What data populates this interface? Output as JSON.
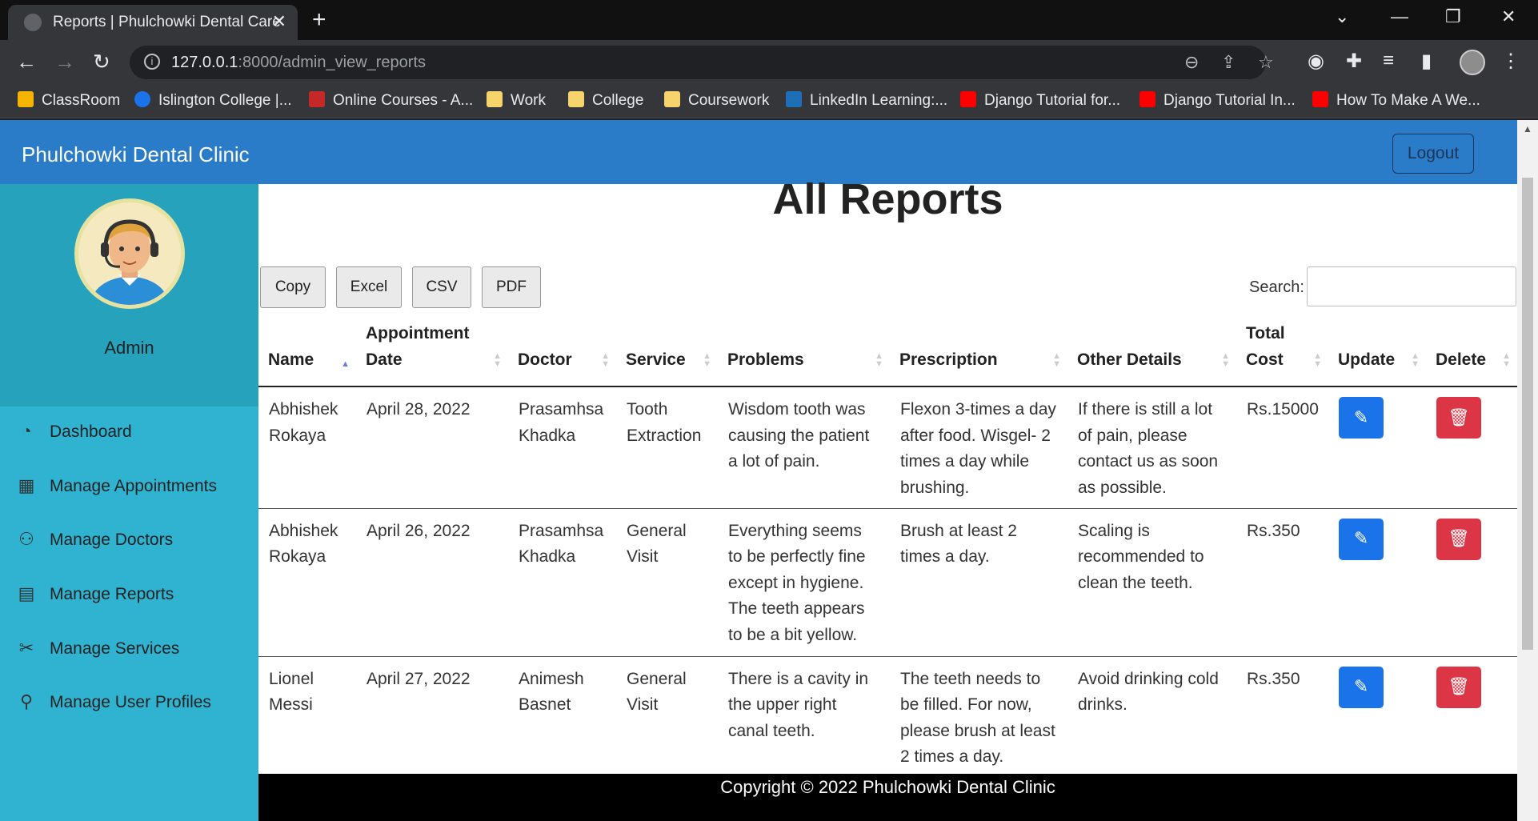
{
  "browser": {
    "tab_title": "Reports | Phulchowki Dental Care",
    "url_host": "127.0.0.1",
    "url_rest": ":8000/admin_view_reports",
    "bookmarks": [
      {
        "label": "ClassRoom",
        "color": "#f4b400"
      },
      {
        "label": "Islington College |...",
        "color": "#1a73e8"
      },
      {
        "label": "Online Courses - A...",
        "color": "#c62828"
      },
      {
        "label": "Work",
        "color": "#f6d36b"
      },
      {
        "label": "College",
        "color": "#f6d36b"
      },
      {
        "label": "Coursework",
        "color": "#f6d36b"
      },
      {
        "label": "LinkedIn Learning:...",
        "color": "#1d6fb8"
      },
      {
        "label": "Django Tutorial for...",
        "color": "#ff0000"
      },
      {
        "label": "Django Tutorial In...",
        "color": "#ff0000"
      },
      {
        "label": "How To Make A We...",
        "color": "#ff0000"
      }
    ]
  },
  "navbar": {
    "brand": "Phulchowki Dental Clinic",
    "logout_label": "Logout"
  },
  "sidebar": {
    "user_label": "Admin",
    "items": [
      {
        "label": "Dashboard",
        "icon": "dashboard-icon"
      },
      {
        "label": "Manage Appointments",
        "icon": "calendar-icon"
      },
      {
        "label": "Manage Doctors",
        "icon": "users-icon"
      },
      {
        "label": "Manage Reports",
        "icon": "report-icon"
      },
      {
        "label": "Manage Services",
        "icon": "tools-icon"
      },
      {
        "label": "Manage User Profiles",
        "icon": "user-icon"
      }
    ]
  },
  "main": {
    "title": "All Reports",
    "export_buttons": [
      "Copy",
      "Excel",
      "CSV",
      "PDF"
    ],
    "search_label": "Search:",
    "search_value": "",
    "columns": [
      "Name",
      "Appointment Date",
      "Doctor",
      "Service",
      "Problems",
      "Prescription",
      "Other Details",
      "Total Cost",
      "Update",
      "Delete"
    ],
    "rows": [
      {
        "name": "Abhishek Rokaya",
        "date": "April 28, 2022",
        "doctor": "Prasamhsa Khadka",
        "service": "Tooth Extraction",
        "problems": "Wisdom tooth was causing the patient a lot of pain.",
        "prescription": "Flexon 3-times a day after food. Wisgel- 2 times a day while brushing.",
        "other": "If there is still a lot of pain, please contact us as soon as possible.",
        "cost": "Rs.15000"
      },
      {
        "name": "Abhishek Rokaya",
        "date": "April 26, 2022",
        "doctor": "Prasamhsa Khadka",
        "service": "General Visit",
        "problems": "Everything seems to be perfectly fine except in hygiene. The teeth appears to be a bit yellow.",
        "prescription": "Brush at least 2 times a day.",
        "other": "Scaling is recommended to clean the teeth.",
        "cost": "Rs.350"
      },
      {
        "name": "Lionel Messi",
        "date": "April 27, 2022",
        "doctor": "Animesh Basnet",
        "service": "General Visit",
        "problems": "There is a cavity in the upper right canal teeth.",
        "prescription": "The teeth needs to be filled. For now, please brush at least 2 times a day.",
        "other": "Avoid drinking cold drinks.",
        "cost": "Rs.350"
      }
    ]
  },
  "footer": {
    "text": "Copyright © 2022 Phulchowki Dental Clinic"
  }
}
